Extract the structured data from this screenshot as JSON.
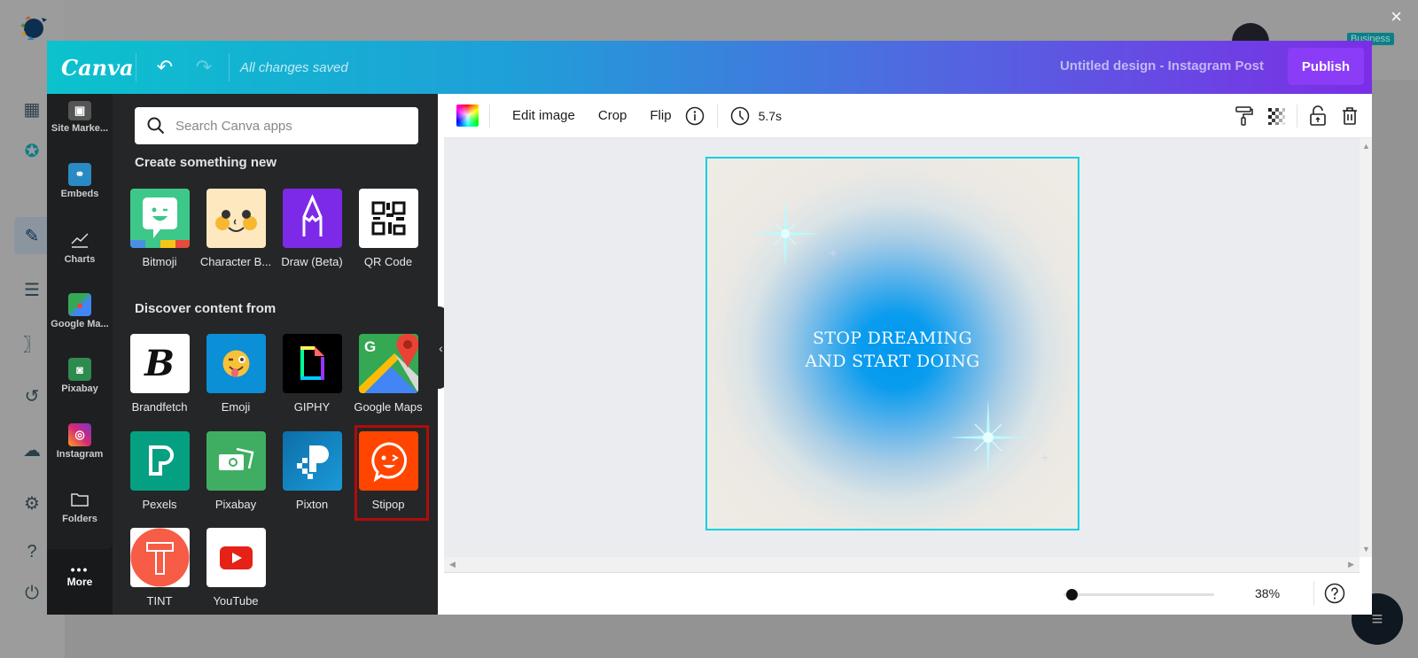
{
  "background": {
    "close_icon": "×",
    "badge": "Business",
    "nav_icons": [
      "dashboard-icon",
      "billing-icon",
      "compose-icon",
      "posts-icon",
      "rss-icon",
      "history-icon",
      "download-icon",
      "settings-icon",
      "help-icon",
      "power-icon"
    ]
  },
  "topbar": {
    "brand": "Canva",
    "undo_icon": "↶",
    "redo_icon": "↷",
    "status": "All changes saved",
    "design_title": "Untitled design - Instagram Post",
    "publish_label": "Publish"
  },
  "rail": {
    "items": [
      {
        "label": "Site Marke...",
        "icon": "site-marketing-icon",
        "color": "#555"
      },
      {
        "label": "Embeds",
        "icon": "embeds-icon",
        "color": "#2a8bc4"
      },
      {
        "label": "Charts",
        "icon": "charts-icon",
        "color": "transparent"
      },
      {
        "label": "Google Ma...",
        "icon": "google-maps-icon",
        "color": "#34a853"
      },
      {
        "label": "Pixabay",
        "icon": "pixabay-icon",
        "color": "#2e8b4e"
      },
      {
        "label": "Instagram",
        "icon": "instagram-icon",
        "color": "#c1358b"
      },
      {
        "label": "Folders",
        "icon": "folder-icon",
        "color": "transparent"
      }
    ],
    "more_label": "More"
  },
  "panel": {
    "search_placeholder": "Search Canva apps",
    "section_create": "Create something new",
    "create_apps": [
      {
        "label": "Bitmoji",
        "color": "#3dc88a"
      },
      {
        "label": "Character B...",
        "color": "#fde8c0"
      },
      {
        "label": "Draw (Beta)",
        "color": "#7d2ae8"
      },
      {
        "label": "QR Code",
        "color": "#ffffff"
      }
    ],
    "section_discover": "Discover content from",
    "discover_apps": [
      {
        "label": "Brandfetch",
        "color": "#ffffff"
      },
      {
        "label": "Emoji",
        "color": "#0b8fd6"
      },
      {
        "label": "GIPHY",
        "color": "#000000"
      },
      {
        "label": "Google Maps",
        "color": "#34a853"
      },
      {
        "label": "Pexels",
        "color": "#05a081"
      },
      {
        "label": "Pixabay",
        "color": "#3fae62"
      },
      {
        "label": "Pixton",
        "color": "#1a8fd2"
      },
      {
        "label": "Stipop",
        "color": "#ff4500",
        "selected": true
      },
      {
        "label": "TINT",
        "color": "#ffffff"
      },
      {
        "label": "YouTube",
        "color": "#ffffff"
      }
    ]
  },
  "context_bar": {
    "edit_image": "Edit image",
    "crop": "Crop",
    "flip": "Flip",
    "duration": "5.7s"
  },
  "design": {
    "line1": "STOP DREAMING",
    "line2": "AND START DOING",
    "border_color": "#13d1de"
  },
  "bottom_bar": {
    "zoom_percent": 38,
    "zoom_label": "38%",
    "zoom_slider_fraction": 0.05
  },
  "colors": {
    "publish": "#8b3cf7",
    "panel_bg": "#252627",
    "selection_outline": "#b00c0c"
  }
}
